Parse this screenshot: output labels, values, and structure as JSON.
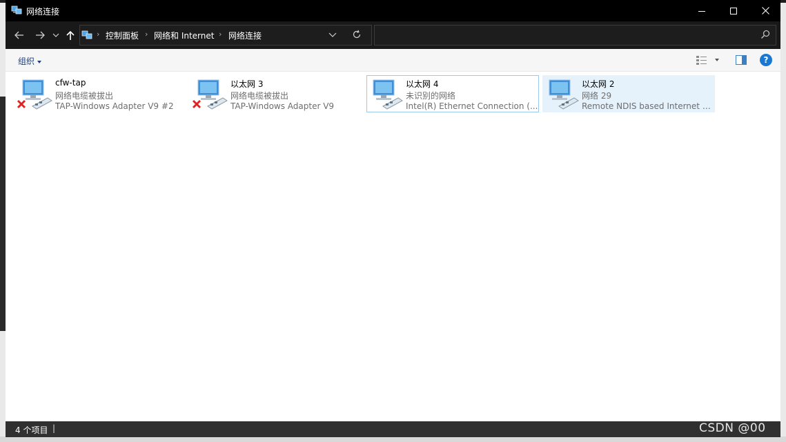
{
  "window": {
    "title": "网络连接"
  },
  "navigation": {
    "breadcrumbs": [
      "控制面板",
      "网络和 Internet",
      "网络连接"
    ],
    "search_placeholder": ""
  },
  "toolbar": {
    "organize_label": "组织",
    "help_label": "?"
  },
  "connections": [
    {
      "name": "cfw-tap",
      "status": "网络电缆被拔出",
      "adapter": "TAP-Windows Adapter V9 #2",
      "disconnected": true
    },
    {
      "name": "以太网 3",
      "status": "网络电缆被拔出",
      "adapter": "TAP-Windows Adapter V9",
      "disconnected": true
    },
    {
      "name": "以太网 4",
      "status": "未识别的网络",
      "adapter": "Intel(R) Ethernet Connection (...",
      "disconnected": false
    },
    {
      "name": "以太网 2",
      "status": "网络 29",
      "adapter": "Remote NDIS based Internet S...",
      "disconnected": false
    }
  ],
  "statusbar": {
    "item_count": "4 个项目",
    "separator": "|"
  },
  "watermark": "CSDN @00",
  "colors": {
    "title_bg": "#000000",
    "address_bg": "#191919",
    "selection_bg": "#e5f1fb",
    "focus_border": "#99c9ef",
    "accent": "#1a78d2"
  }
}
